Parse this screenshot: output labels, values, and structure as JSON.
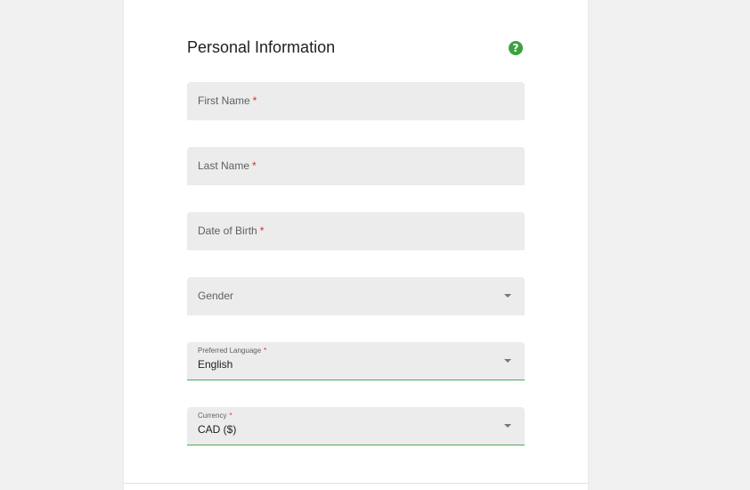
{
  "section": {
    "title": "Personal Information",
    "help_icon": "question-mark-icon"
  },
  "fields": {
    "first_name": {
      "label": "First Name",
      "required": "*"
    },
    "last_name": {
      "label": "Last Name",
      "required": "*"
    },
    "dob": {
      "label": "Date of Birth",
      "required": "*"
    },
    "gender": {
      "label": "Gender"
    },
    "language": {
      "label": "Preferred Language",
      "required": "*",
      "value": "English"
    },
    "currency": {
      "label": "Currency",
      "required": "*",
      "value": "CAD ($)"
    }
  },
  "colors": {
    "accent": "#4caf50",
    "help_icon_bg": "#3aa33f",
    "required": "#d32f2f",
    "field_bg": "#ececec"
  }
}
